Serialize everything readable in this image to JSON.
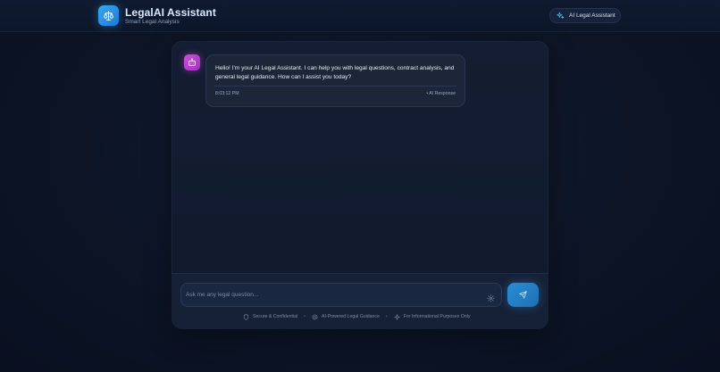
{
  "header": {
    "title": "LegalAI Assistant",
    "subtitle": "Smart Legal Analysis",
    "badge_label": "AI Legal Assistant",
    "logo_icon": "scales-icon",
    "badge_icon": "sparkle-icon"
  },
  "chat": {
    "messages": [
      {
        "role": "assistant",
        "avatar_icon": "robot-icon",
        "text": "Hello! I'm your AI Legal Assistant. I can help you with legal questions, contract analysis, and general legal guidance. How can I assist you today?",
        "time": "8:03:12 PM",
        "tag": "• AI Response"
      }
    ]
  },
  "composer": {
    "placeholder": "Ask me any legal question...",
    "settings_icon": "gear-icon",
    "send_icon": "send-icon"
  },
  "footer": {
    "items": [
      {
        "icon": "shield-icon",
        "label": "Secure & Confidential"
      },
      {
        "icon": "ai-chip-icon",
        "label": "AI-Powered Legal Guidance"
      },
      {
        "icon": "sparkle-icon",
        "label": "For Informational Purposes Only"
      }
    ],
    "separator": "•"
  },
  "colors": {
    "accent_blue": "#2a8ed4",
    "accent_purple": "#c445d4",
    "background": "#0c1426"
  }
}
